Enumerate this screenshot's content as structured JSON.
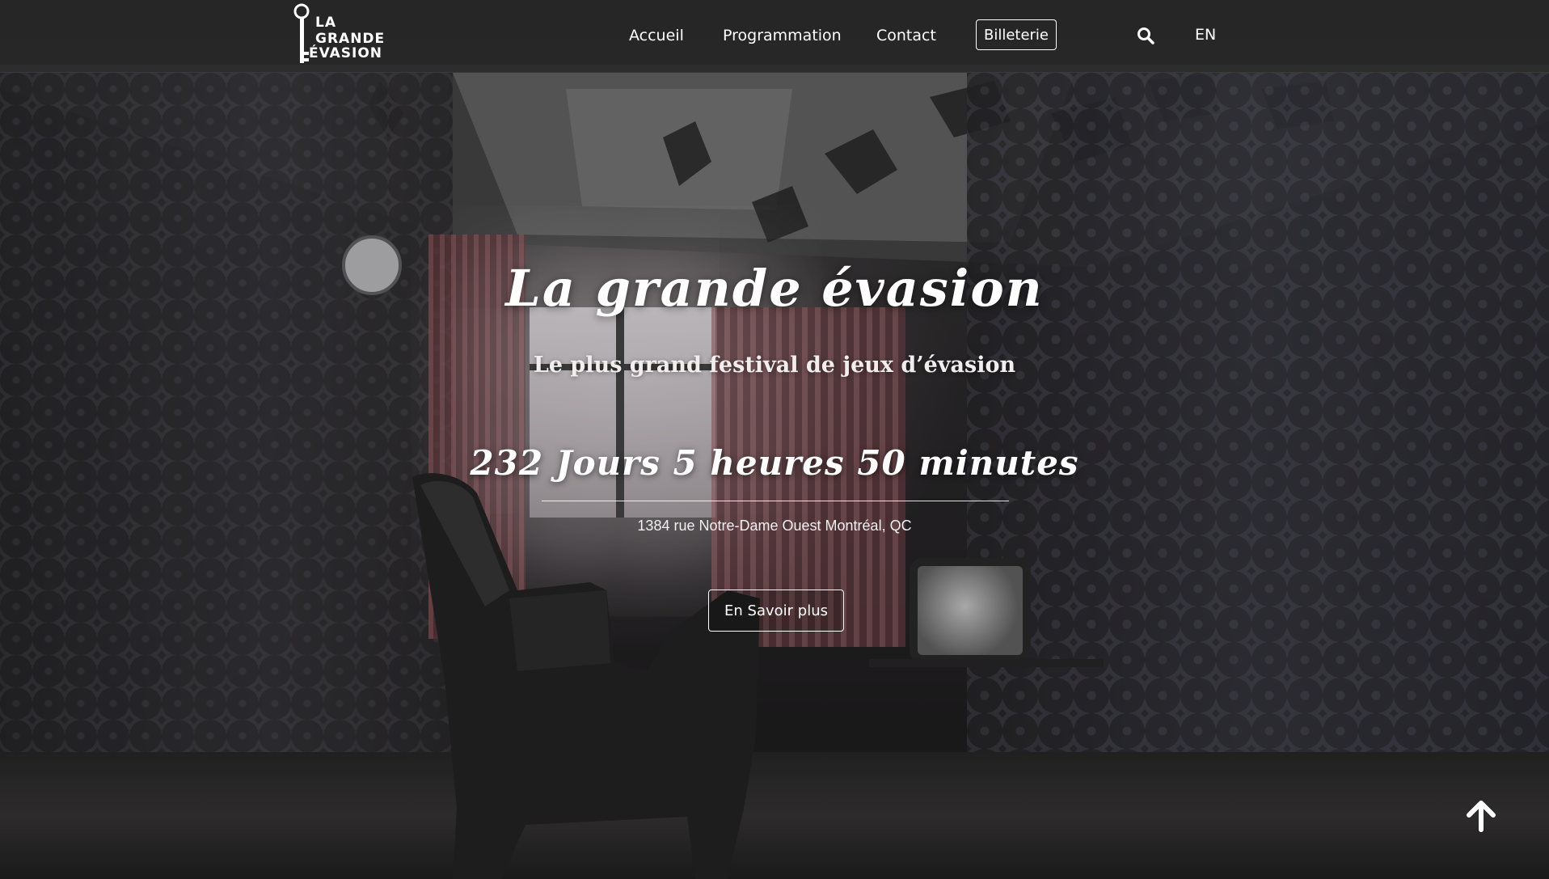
{
  "header": {
    "logo_lines": [
      "LA",
      "GRANDE",
      "ÉVASION"
    ],
    "nav": {
      "home": "Accueil",
      "program": "Programmation",
      "contact": "Contact",
      "tickets": "Billeterie",
      "language": "EN"
    }
  },
  "hero": {
    "title": "La grande évasion",
    "subtitle": "Le plus grand festival de jeux d’évasion",
    "countdown": "232 Jours 5 heures 50 minutes",
    "address": "1384 rue Notre-Dame Ouest Montréal, QC",
    "cta_label": "En Savoir plus"
  },
  "icons": {
    "search": "search-icon",
    "scroll_top": "arrow-up-icon",
    "logo_key": "key-icon"
  },
  "colors": {
    "header_bg": "#282828",
    "text": "#ffffff"
  }
}
